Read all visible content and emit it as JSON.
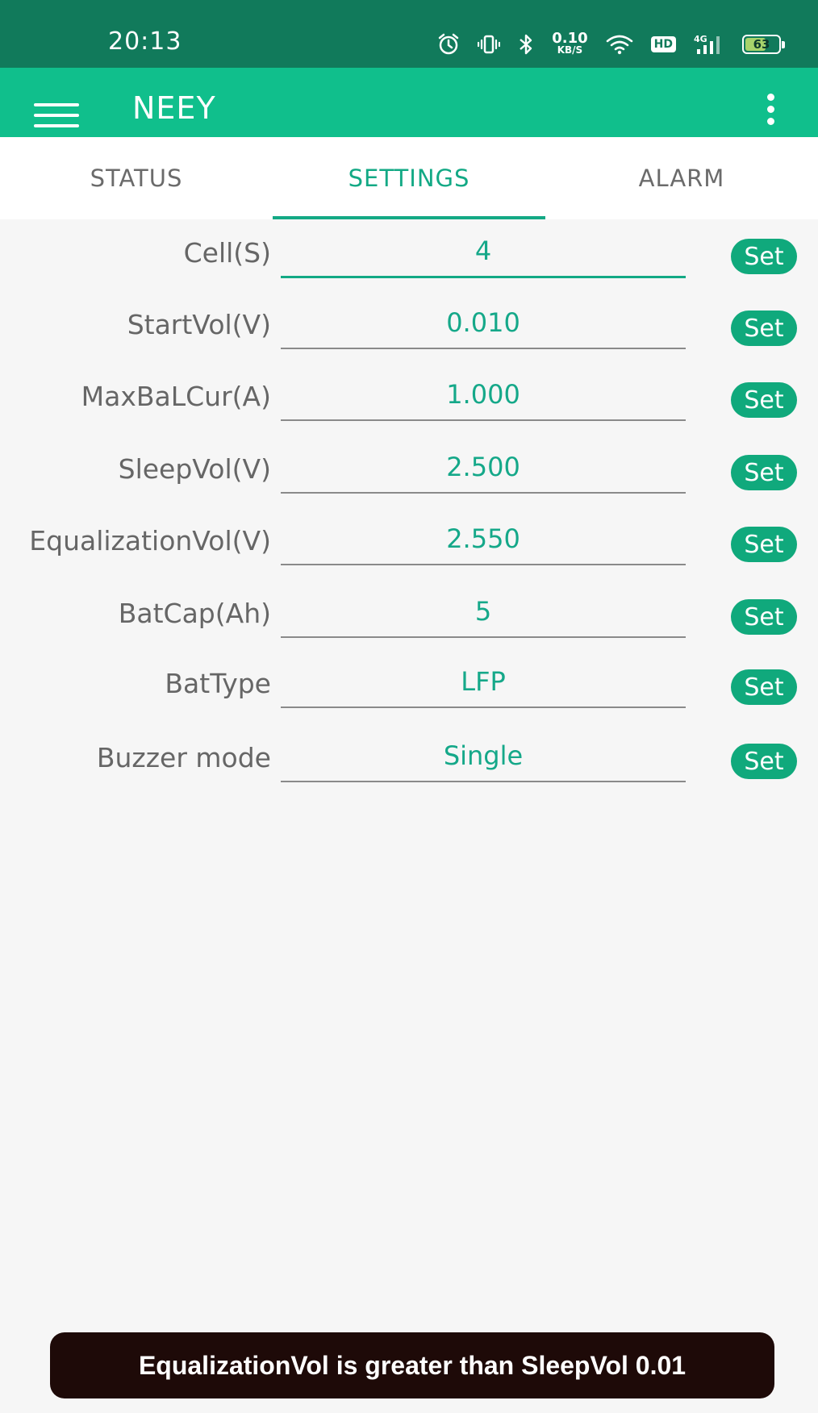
{
  "status_bar": {
    "time": "20:13",
    "net_speed_value": "0.10",
    "net_speed_unit": "KB/S",
    "hd_badge": "HD",
    "signal_label": "4G",
    "battery_level": "63",
    "battery_percent": 63,
    "icons": [
      "alarm-icon",
      "vibrate-icon",
      "bluetooth-icon",
      "wifi-icon",
      "signal-icon",
      "battery-icon"
    ]
  },
  "app_bar": {
    "title": "NEEY"
  },
  "tabs": [
    {
      "label": "STATUS",
      "active": false
    },
    {
      "label": "SETTINGS",
      "active": true
    },
    {
      "label": "ALARM",
      "active": false
    }
  ],
  "settings": [
    {
      "label": "Cell(S)",
      "value": "4",
      "button": "Set"
    },
    {
      "label": "StartVol(V)",
      "value": "0.010",
      "button": "Set"
    },
    {
      "label": "MaxBaLCur(A)",
      "value": "1.000",
      "button": "Set"
    },
    {
      "label": "SleepVol(V)",
      "value": "2.500",
      "button": "Set"
    },
    {
      "label": "EqualizationVol(V)",
      "value": "2.550",
      "button": "Set"
    },
    {
      "label": "BatCap(Ah)",
      "value": "5",
      "button": "Set"
    },
    {
      "label": "BatType",
      "value": "LFP",
      "button": "Set"
    },
    {
      "label": "Buzzer mode",
      "value": "Single",
      "button": "Set"
    }
  ],
  "toast": {
    "message": "EqualizationVol is greater than SleepVol 0.01"
  },
  "colors": {
    "status_bar": "#117a5b",
    "app_bar": "#10bf8c",
    "accent": "#13a985",
    "button": "#10a97c",
    "toast_bg": "#1e0a08"
  }
}
